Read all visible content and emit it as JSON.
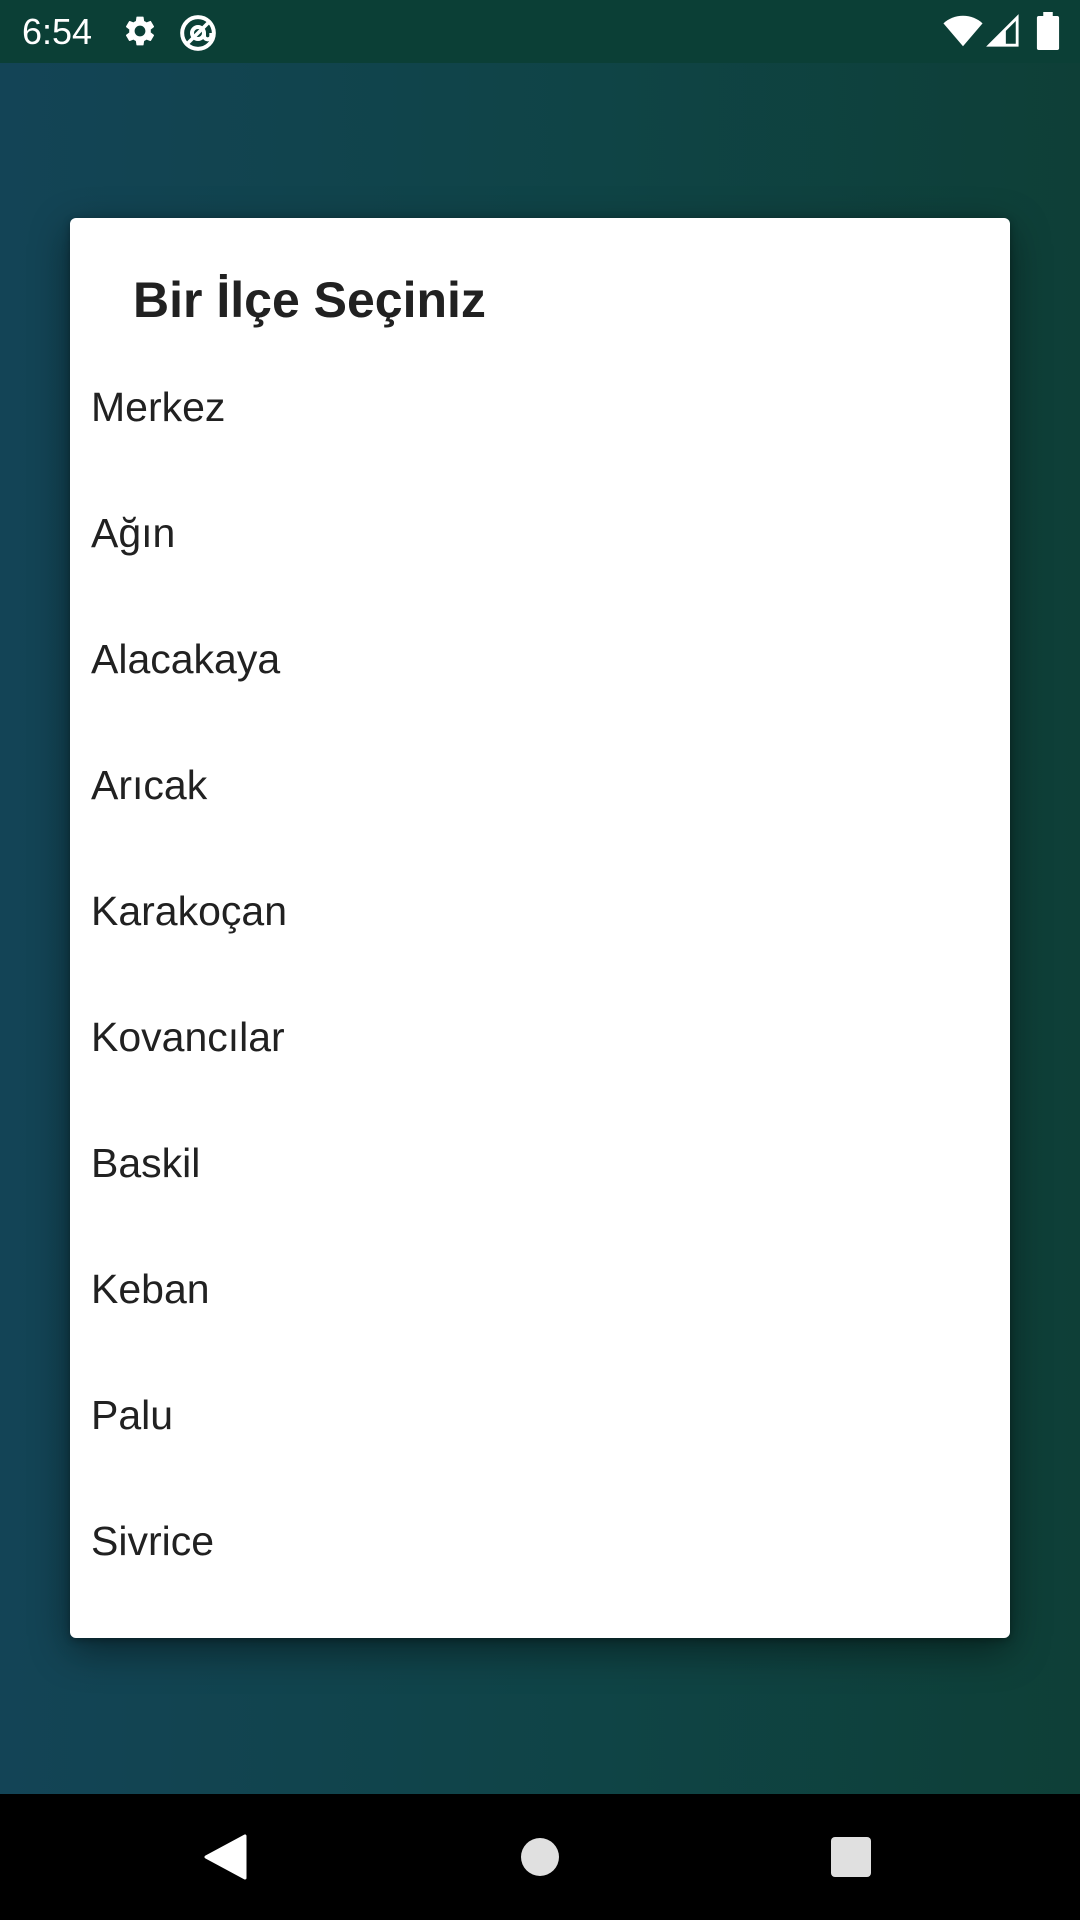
{
  "status_bar": {
    "time": "6:54",
    "left_icons": [
      "gear-icon",
      "at-sign-icon"
    ],
    "right_icons": [
      "wifi-icon",
      "signal-icon",
      "battery-icon"
    ]
  },
  "dialog": {
    "title": "Bir İlçe Seçiniz",
    "items": [
      "Merkez",
      "Ağın",
      "Alacakaya",
      "Arıcak",
      "Karakoçan",
      "Kovancılar",
      "Baskil",
      "Keban",
      "Palu",
      "Sivrice"
    ]
  },
  "nav_bar": {
    "buttons": [
      "back-icon",
      "home-icon",
      "recents-icon"
    ]
  },
  "colors": {
    "background_start": "#134456",
    "background_end": "#0e3f37",
    "status_bar": "#0b3f36",
    "dialog_bg": "#ffffff",
    "text": "#212121",
    "nav_bar": "#000000"
  }
}
